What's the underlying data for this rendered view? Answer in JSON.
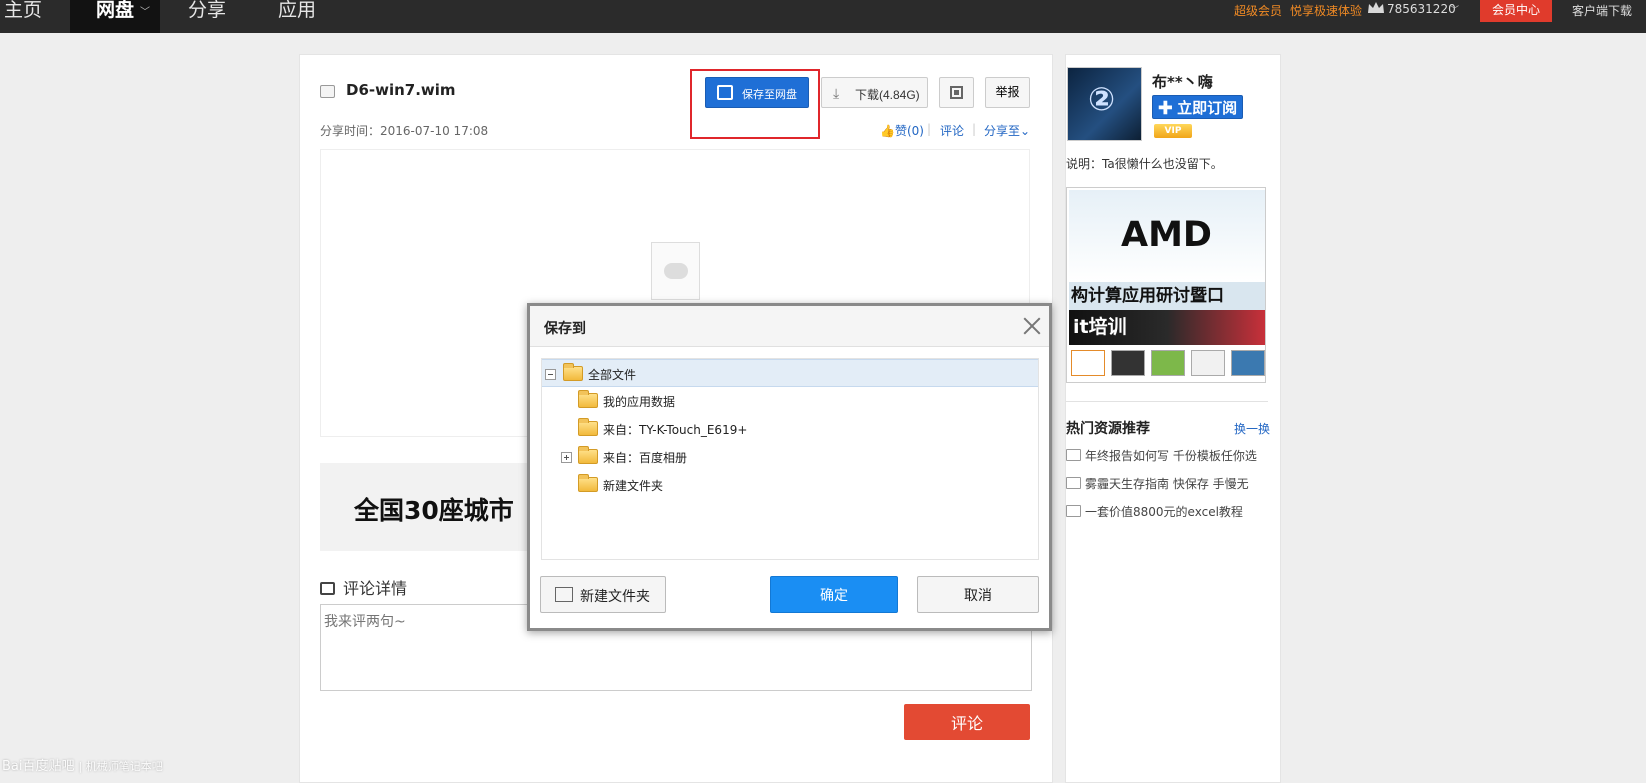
{
  "nav": {
    "home": "主页",
    "pan": "网盘",
    "share": "分享",
    "app": "应用"
  },
  "topbar_right": {
    "super_vip": "超级会员",
    "speed_trial": "悦享极速体验",
    "user_id": "785631220",
    "member_center": "会员中心",
    "client_download": "客户端下载"
  },
  "file": {
    "name": "D6-win7.wim",
    "share_time": "分享时间：2016-07-10 17:08",
    "save_label": "保存至网盘",
    "download_label": "下载(4.84G)",
    "report_label": "举报",
    "like_label": "赞(0)",
    "comment_link": "评论",
    "share_to": "分享至"
  },
  "banner": {
    "text": "全国30座城市"
  },
  "comments": {
    "heading": "评论详情",
    "placeholder": "我来评两句~",
    "submit_label": "评论"
  },
  "sidebar": {
    "username": "布**丶嗨",
    "subscribe_label": "立即订阅",
    "vip_badge": "VIP",
    "description": "说明：Ta很懒什么也没留下。",
    "ad": {
      "brand": "AMD",
      "line1": "构计算应用研讨暨口",
      "line2": "it培训"
    },
    "hot": {
      "title": "热门资源推荐",
      "swap_label": "换一换",
      "items": [
        "年终报告如何写 千份模板任你选",
        "雾霾天生存指南 快保存 手慢无",
        "一套价值8800元的excel教程"
      ]
    }
  },
  "modal": {
    "title": "保存到",
    "tree": [
      "全部文件",
      "我的应用数据",
      "来自：TY-K-Touch_E619+",
      "来自：百度相册",
      "新建文件夹"
    ],
    "new_folder_label": "新建文件夹",
    "ok_label": "确定",
    "cancel_label": "取消"
  },
  "watermark": {
    "logo": "Bai百度贴吧",
    "sub": "| 机械师笔记本吧"
  },
  "colors": {
    "primary_blue": "#1f6fd6",
    "ok_blue": "#1a8ef3",
    "red": "#e34a33",
    "topbar": "#2b2b2b",
    "highlight_frame": "#e0262b"
  }
}
